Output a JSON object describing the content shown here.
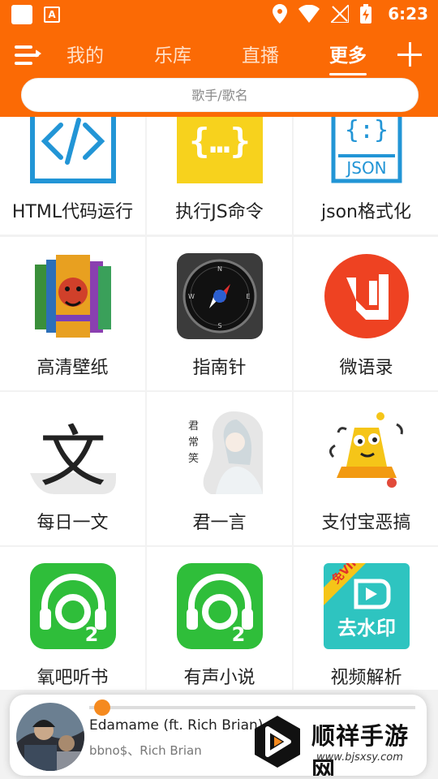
{
  "status_bar": {
    "time": "6:23"
  },
  "header": {
    "tabs": [
      {
        "label": "我的",
        "active": false
      },
      {
        "label": "乐库",
        "active": false
      },
      {
        "label": "直播",
        "active": false
      },
      {
        "label": "更多",
        "active": true
      }
    ],
    "search_placeholder": "歌手/歌名"
  },
  "grid": {
    "items": [
      {
        "label": "HTML代码运行",
        "icon": "html-code-icon"
      },
      {
        "label": "执行JS命令",
        "icon": "js-braces-icon"
      },
      {
        "label": "json格式化",
        "icon": "json-file-icon"
      },
      {
        "label": "高清壁纸",
        "icon": "wallpaper-icon"
      },
      {
        "label": "指南针",
        "icon": "compass-icon"
      },
      {
        "label": "微语录",
        "icon": "quotes-icon"
      },
      {
        "label": "每日一文",
        "icon": "wen-character-icon"
      },
      {
        "label": "君一言",
        "icon": "portrait-icon"
      },
      {
        "label": "支付宝恶搞",
        "icon": "bell-icon"
      },
      {
        "label": "氧吧听书",
        "icon": "headphones-o2-icon"
      },
      {
        "label": "有声小说",
        "icon": "headphones-o2-icon"
      },
      {
        "label": "视频解析",
        "icon": "video-parse-icon"
      }
    ]
  },
  "icon_text": {
    "json": "JSON",
    "wen": "文",
    "portrait_seal": "君\n常\n笑",
    "vip": "免VIP",
    "watermark_removal": "去水印",
    "o2_sub": "2"
  },
  "player": {
    "song_title": "Edamame (ft. Rich Brian)",
    "artist": "bbno$、Rich Brian",
    "progress": 0.02
  },
  "watermark": {
    "name": "顺祥手游网",
    "url": "www.bjsxsy.com"
  },
  "colors": {
    "accent": "#fb6a05",
    "divider": "#f2f2f2"
  }
}
